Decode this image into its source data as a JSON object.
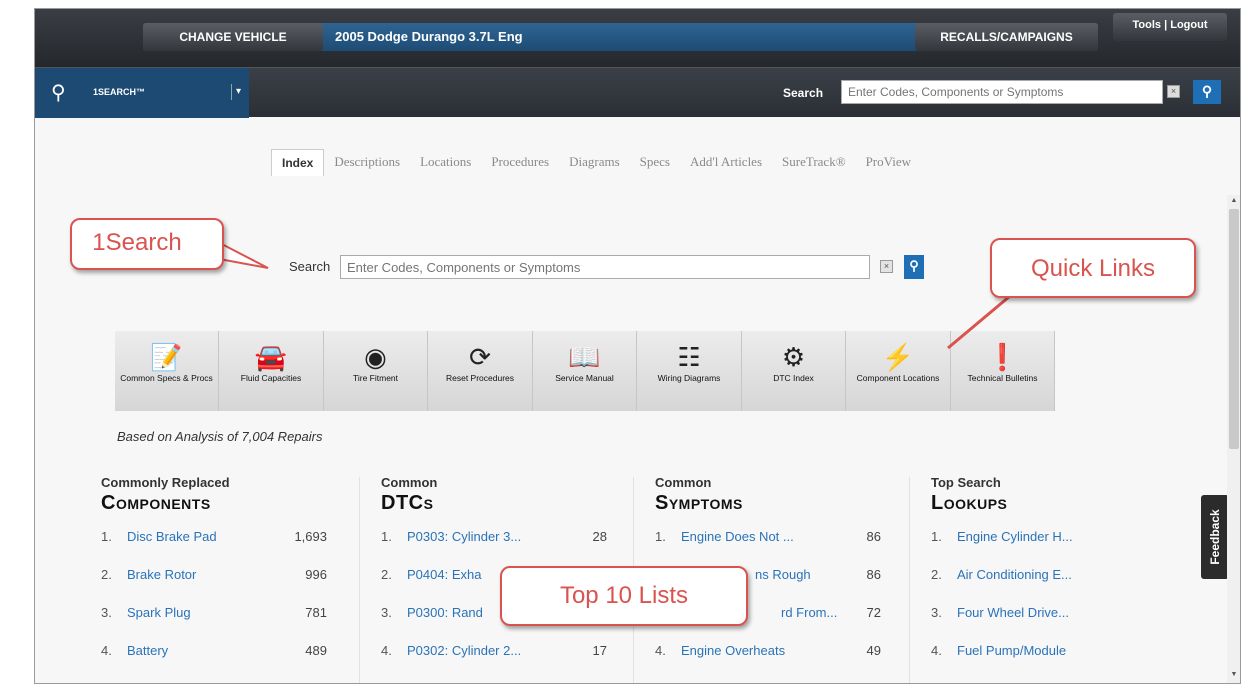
{
  "header": {
    "change_vehicle": "CHANGE VEHICLE",
    "vehicle": "2005 Dodge Durango 3.7L Eng",
    "recalls": "RECALLS/CAMPAIGNS",
    "tools": "Tools | Logout"
  },
  "searchbar": {
    "brand": "1SEARCH™",
    "label": "Search",
    "placeholder": "Enter Codes, Components or Symptoms"
  },
  "tabs": [
    "Index",
    "Descriptions",
    "Locations",
    "Procedures",
    "Diagrams",
    "Specs",
    "Add'l Articles",
    "SureTrack®",
    "ProView"
  ],
  "main_search": {
    "label": "Search",
    "placeholder": "Enter Codes, Components or Symptoms"
  },
  "quick_links": [
    {
      "label": "Common Specs & Procs",
      "icon": "specs-icon"
    },
    {
      "label": "Fluid Capacities",
      "icon": "fluid-car-icon"
    },
    {
      "label": "Tire Fitment",
      "icon": "tire-icon"
    },
    {
      "label": "Reset Procedures",
      "icon": "reset-icon"
    },
    {
      "label": "Service Manual",
      "icon": "book-icon"
    },
    {
      "label": "Wiring Diagrams",
      "icon": "wiring-icon"
    },
    {
      "label": "DTC Index",
      "icon": "engine-icon"
    },
    {
      "label": "Component Locations",
      "icon": "location-icon"
    },
    {
      "label": "Technical Bulletins",
      "icon": "bulletin-icon"
    }
  ],
  "analysis_text": "Based on Analysis of 7,004 Repairs",
  "columns": [
    {
      "sub": "Commonly Replaced",
      "title": "Components",
      "rows": [
        {
          "num": "1.",
          "label": "Disc Brake Pad",
          "count": "1,693"
        },
        {
          "num": "2.",
          "label": "Brake Rotor",
          "count": "996"
        },
        {
          "num": "3.",
          "label": "Spark Plug",
          "count": "781"
        },
        {
          "num": "4.",
          "label": "Battery",
          "count": "489"
        }
      ]
    },
    {
      "sub": "Common",
      "title": "DTCs",
      "rows": [
        {
          "num": "1.",
          "label": "P0303: Cylinder 3...",
          "count": "28"
        },
        {
          "num": "2.",
          "label": "P0404: Exha",
          "count": ""
        },
        {
          "num": "3.",
          "label": "P0300: Rand",
          "count": ""
        },
        {
          "num": "4.",
          "label": "P0302: Cylinder 2...",
          "count": "17"
        }
      ]
    },
    {
      "sub": "Common",
      "title": "Symptoms",
      "rows": [
        {
          "num": "1.",
          "label": "Engine Does Not ...",
          "count": "86"
        },
        {
          "num": "",
          "label": "ns Rough",
          "count": "86"
        },
        {
          "num": "",
          "label": "rd From...",
          "count": "72"
        },
        {
          "num": "4.",
          "label": "Engine Overheats",
          "count": "49"
        }
      ]
    },
    {
      "sub": "Top Search",
      "title": "Lookups",
      "rows": [
        {
          "num": "1.",
          "label": "Engine Cylinder H...",
          "count": ""
        },
        {
          "num": "2.",
          "label": "Air Conditioning E...",
          "count": ""
        },
        {
          "num": "3.",
          "label": "Four Wheel Drive...",
          "count": ""
        },
        {
          "num": "4.",
          "label": "Fuel Pump/Module",
          "count": ""
        }
      ]
    }
  ],
  "feedback": "Feedback",
  "callouts": {
    "onesearch": "1Search",
    "quicklinks": "Quick Links",
    "top10": "Top 10 Lists"
  },
  "colors": {
    "accent_blue": "#1e6fb6",
    "link": "#2a73b8",
    "callout": "#d9534f",
    "vehicle_bar": "#1d4c75"
  }
}
